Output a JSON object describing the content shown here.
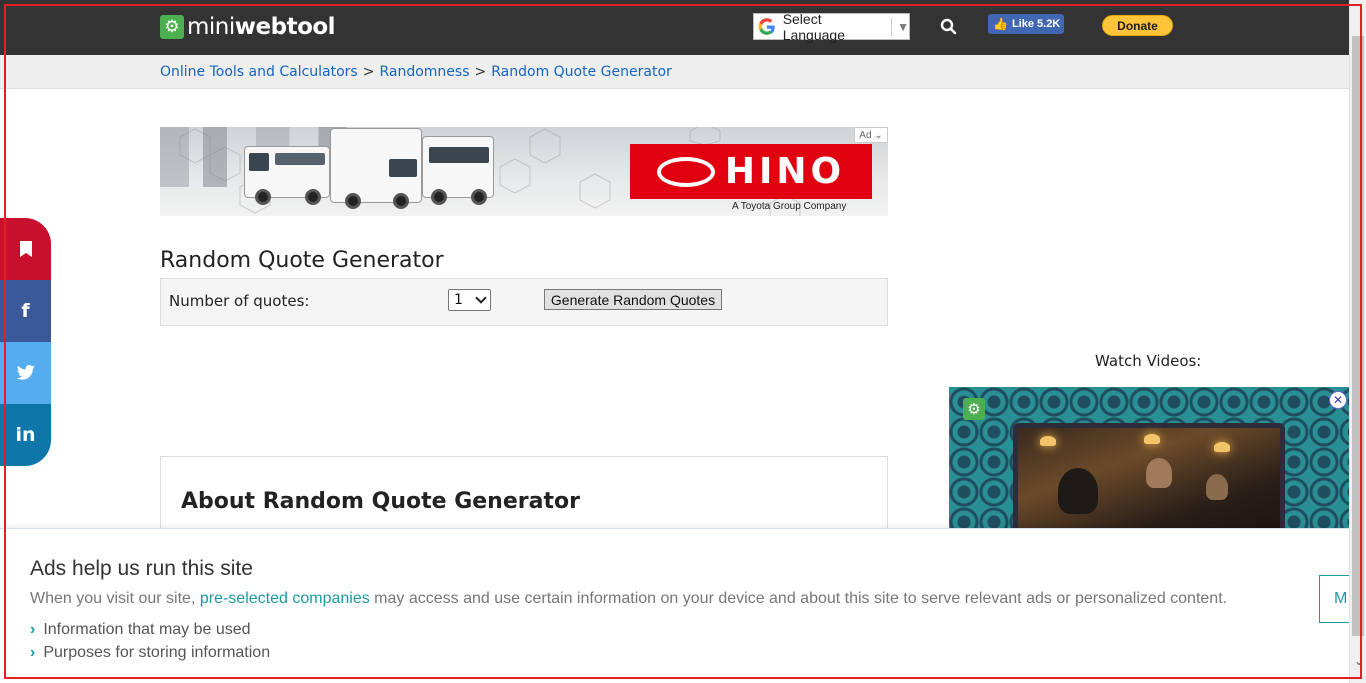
{
  "header": {
    "logo_text_light": "mini",
    "logo_text_bold": "webtool",
    "language_label": "Select Language",
    "like_label": "Like 5.2K",
    "donate_label": "Donate"
  },
  "breadcrumb": {
    "items": [
      "Online Tools and Calculators",
      "Randomness",
      "Random Quote Generator"
    ],
    "separator": ">"
  },
  "ad": {
    "brand": "HINO",
    "tagline": "A Toyota Group Company",
    "chip": "Ad"
  },
  "tool": {
    "title": "Random Quote Generator",
    "quantity_label": "Number of quotes:",
    "quantity_value": "1",
    "generate_label": "Generate Random Quotes"
  },
  "about": {
    "title": "About Random Quote Generator"
  },
  "sidebar": {
    "watch_label": "Watch Videos:"
  },
  "consent": {
    "title": "Ads help us run this site",
    "desc_before": "When you visit our site, ",
    "desc_link": "pre-selected companies",
    "desc_after": " may access and use certain information on your device and about this site to serve relevant ads or personalized content.",
    "options": [
      "Information that may be used",
      "Purposes for storing information"
    ],
    "more_label": "M"
  },
  "colors": {
    "header_bg": "#333333",
    "link": "#1565c0",
    "accent": "#1c9aa5",
    "frame": "#e31e24"
  },
  "icons": [
    "gear-icon",
    "google-icon",
    "search-icon",
    "like-thumb-icon",
    "bookmark-icon",
    "facebook-icon",
    "twitter-icon",
    "linkedin-icon",
    "close-icon",
    "chevron-right-icon",
    "chevron-down-icon"
  ]
}
